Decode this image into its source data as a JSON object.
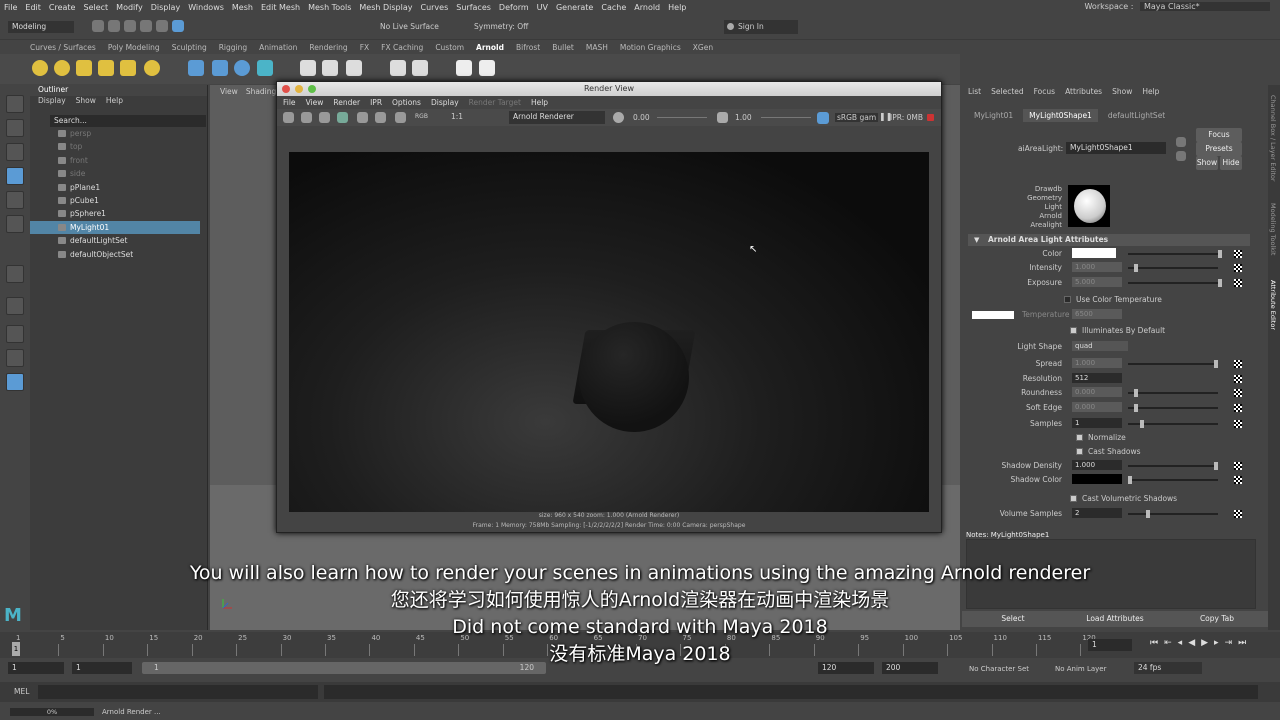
{
  "menubar": [
    "File",
    "Edit",
    "Create",
    "Select",
    "Modify",
    "Display",
    "Windows",
    "Mesh",
    "Edit Mesh",
    "Mesh Tools",
    "Mesh Display",
    "Curves",
    "Surfaces",
    "Deform",
    "UV",
    "Generate",
    "Cache",
    "Arnold",
    "Help"
  ],
  "workspace": {
    "label": "Workspace :",
    "value": "Maya Classic*"
  },
  "toolbar": {
    "mode": "Modeling",
    "live_surface": "No Live Surface",
    "symmetry": "Symmetry: Off",
    "sign_in": "Sign In"
  },
  "shelf_tabs": [
    "Curves / Surfaces",
    "Poly Modeling",
    "Sculpting",
    "Rigging",
    "Animation",
    "Rendering",
    "FX",
    "FX Caching",
    "Custom",
    "Arnold",
    "Bifrost",
    "Bullet",
    "MASH",
    "Motion Graphics",
    "XGen"
  ],
  "outliner": {
    "title": "Outliner",
    "menu": [
      "Display",
      "Show",
      "Help"
    ],
    "search": "Search...",
    "items": [
      {
        "label": "persp",
        "dim": true
      },
      {
        "label": "top",
        "dim": true
      },
      {
        "label": "front",
        "dim": true
      },
      {
        "label": "side",
        "dim": true
      },
      {
        "label": "pPlane1"
      },
      {
        "label": "pCube1"
      },
      {
        "label": "pSphere1"
      },
      {
        "label": "MyLight01",
        "selected": true
      },
      {
        "label": "defaultLightSet"
      },
      {
        "label": "defaultObjectSet"
      }
    ]
  },
  "viewport": {
    "menu": [
      "View",
      "Shading"
    ]
  },
  "render_view": {
    "title": "Render View",
    "menu": [
      "File",
      "View",
      "Render",
      "IPR",
      "Options",
      "Display",
      "Render Target",
      "Help"
    ],
    "renderer": "Arnold Renderer",
    "exposure": "0.00",
    "gamma": "1.00",
    "ratio": "1:1",
    "rgb": "RGB",
    "colorspace": "sRGB gam",
    "ipr": "IPR: 0MB",
    "info1": "size: 960 x 540  zoom: 1.000    (Arnold Renderer)",
    "info2": "Frame: 1    Memory: 758Mb    Sampling: [-1/2/2/2/2/2]    Render Time: 0:00    Camera: perspShape"
  },
  "attr_editor": {
    "menu": [
      "List",
      "Selected",
      "Focus",
      "Attributes",
      "Show",
      "Help"
    ],
    "tabs": [
      "MyLight01",
      "MyLight0Shape1",
      "defaultLightSet"
    ],
    "node_label": "aiAreaLight:",
    "node_value": "MyLight0Shape1",
    "focus": "Focus",
    "presets": "Presets",
    "show": "Show",
    "hide": "Hide",
    "swatch_label": [
      "Drawdb",
      "Geometry",
      "Light",
      "Arnold",
      "Arealight"
    ],
    "section": "Arnold Area Light Attributes",
    "attrs": [
      {
        "label": "Color",
        "value": ""
      },
      {
        "label": "Intensity",
        "value": "1.000",
        "dim": true
      },
      {
        "label": "Exposure",
        "value": "5.000",
        "dim": true
      }
    ],
    "use_color_temp": "Use Color Temperature",
    "temp_label": "Temperature",
    "temp_value": "6500",
    "illuminates": "Illuminates By Default",
    "light_shape_label": "Light Shape",
    "light_shape": "quad",
    "attrs2": [
      {
        "label": "Spread",
        "value": "1.000",
        "dim": true
      },
      {
        "label": "Resolution",
        "value": "512"
      },
      {
        "label": "Roundness",
        "value": "0.000",
        "dim": true
      },
      {
        "label": "Soft Edge",
        "value": "0.000",
        "dim": true
      },
      {
        "label": "Samples",
        "value": "1"
      }
    ],
    "normalize": "Normalize",
    "cast_shadows": "Cast Shadows",
    "shadow_density_label": "Shadow Density",
    "shadow_density": "1.000",
    "shadow_color_label": "Shadow Color",
    "cast_vol": "Cast Volumetric Shadows",
    "vol_samples_label": "Volume Samples",
    "vol_samples": "2",
    "notes": "Notes:  MyLight0Shape1",
    "select": "Select",
    "load": "Load Attributes",
    "copy": "Copy Tab"
  },
  "side_tabs": [
    "Channel Box / Layer Editor",
    "Modeling Toolkit",
    "Attribute Editor"
  ],
  "timeline": {
    "ticks": [
      "1",
      "5",
      "10",
      "15",
      "20",
      "25",
      "30",
      "35",
      "40",
      "45",
      "50",
      "55",
      "60",
      "65",
      "70",
      "75",
      "80",
      "85",
      "90",
      "95",
      "100",
      "105",
      "110",
      "115",
      "120"
    ],
    "current": "1",
    "frame_field": "1"
  },
  "range": {
    "start": "1",
    "start2": "1",
    "range_start": "1",
    "range_end": "120",
    "end": "120",
    "end2": "200",
    "character": "No Character Set",
    "anim_layer": "No Anim Layer",
    "fps": "24 fps"
  },
  "cmd": {
    "label": "MEL"
  },
  "help": {
    "progress": "0%",
    "status": "Arnold Render ..."
  },
  "subtitles": [
    "You will also learn how to render your scenes in animations using the amazing Arnold renderer",
    "您还将学习如何使用惊人的Arnold渲染器在动画中渲染场景",
    "Did not come standard with Maya 2018",
    "没有标准Maya 2018"
  ],
  "colors": {
    "selection": "#5285a6",
    "accent": "#5b9bd5"
  }
}
